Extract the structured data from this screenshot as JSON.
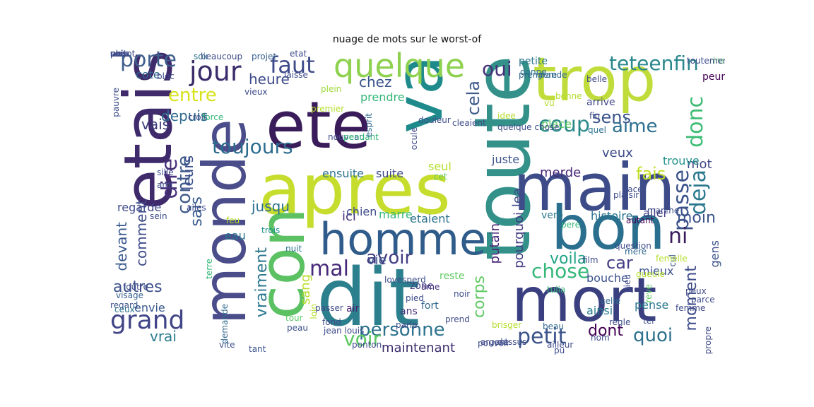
{
  "title": "nuage de mots sur le worst-of",
  "words": [
    {
      "t": "ete",
      "c": "#3b1c5a"
    },
    {
      "t": "etais",
      "c": "#3f2a6b"
    },
    {
      "t": "monde",
      "c": "#4a4d8a"
    },
    {
      "t": "apres",
      "c": "#c6dd2e"
    },
    {
      "t": "dit",
      "c": "#2c7f8c"
    },
    {
      "t": "toute",
      "c": "#33918a"
    },
    {
      "t": "main",
      "c": "#3d4c89"
    },
    {
      "t": "trop",
      "c": "#bfdc3a"
    },
    {
      "t": "bon",
      "c": "#2a6f8e"
    },
    {
      "t": "mort",
      "c": "#3a3f7f"
    },
    {
      "t": "va",
      "c": "#1e8a8b"
    },
    {
      "t": "con",
      "c": "#5bc163"
    },
    {
      "t": "homme",
      "c": "#2f5c8a"
    },
    {
      "t": "quelque",
      "c": "#8ed14f"
    },
    {
      "t": "jour",
      "c": "#3b2c6a"
    },
    {
      "t": "faut",
      "c": "#3e4a89"
    },
    {
      "t": "teteenfin",
      "c": "#2a878c"
    },
    {
      "t": "porte",
      "c": "#3f5f8d"
    },
    {
      "t": "entre",
      "c": "#d8e21f"
    },
    {
      "t": "toujours",
      "c": "#2d6d8e"
    },
    {
      "t": "coup",
      "c": "#2a8a89"
    },
    {
      "t": "oui",
      "c": "#46317a"
    },
    {
      "t": "cela",
      "c": "#3e5a8c"
    },
    {
      "t": "donc",
      "c": "#3dbc74"
    },
    {
      "t": "aime",
      "c": "#2c6f8e"
    },
    {
      "t": "sens",
      "c": "#3a548b"
    },
    {
      "t": "heure",
      "c": "#3e4b89"
    },
    {
      "t": "depuis",
      "c": "#2e6a8e"
    },
    {
      "t": "vais",
      "c": "#3d3b7c"
    },
    {
      "t": "grand",
      "c": "#414487"
    },
    {
      "t": "autres",
      "c": "#3c518b"
    },
    {
      "t": "dire",
      "c": "#46307a"
    },
    {
      "t": "contre",
      "c": "#3f5a8c"
    },
    {
      "t": "mal",
      "c": "#482979"
    },
    {
      "t": "avoir",
      "c": "#433e85"
    },
    {
      "t": "chose",
      "c": "#35b779"
    },
    {
      "t": "car",
      "c": "#433d84"
    },
    {
      "t": "deja",
      "c": "#2a788e"
    },
    {
      "t": "passe",
      "c": "#3b528b"
    },
    {
      "t": "personne",
      "c": "#2c728e"
    },
    {
      "t": "voir",
      "c": "#5ec962"
    },
    {
      "t": "quoi",
      "c": "#2c728e"
    },
    {
      "t": "petit",
      "c": "#3b528b"
    },
    {
      "t": "dont",
      "c": "#440154"
    },
    {
      "t": "maintenant",
      "c": "#3b2e6e"
    },
    {
      "t": "vrai",
      "c": "#2a7a8e"
    },
    {
      "t": "moin",
      "c": "#3b528b"
    },
    {
      "t": "ni",
      "c": "#3a1c5c"
    },
    {
      "t": "merde",
      "c": "#482777"
    },
    {
      "t": "mot",
      "c": "#404688"
    },
    {
      "t": "fais",
      "c": "#c2df23"
    },
    {
      "t": "veux",
      "c": "#3e4c8a"
    },
    {
      "t": "chez",
      "c": "#3a548c"
    },
    {
      "t": "jusqu",
      "c": "#2d708e"
    },
    {
      "t": "vraiment",
      "c": "#2a778e"
    },
    {
      "t": "sang",
      "c": "#b8de29"
    },
    {
      "t": "corps",
      "c": "#5ec962"
    },
    {
      "t": "moment",
      "c": "#3e4a89"
    },
    {
      "t": "devant",
      "c": "#38588c"
    },
    {
      "t": "comment",
      "c": "#3e4c8a"
    },
    {
      "t": "sais",
      "c": "#38598c"
    },
    {
      "t": "leurs",
      "c": "#3c4f8a"
    },
    {
      "t": "envie",
      "c": "#38588c"
    },
    {
      "t": "vie",
      "c": "#3b518b"
    },
    {
      "t": "eau",
      "c": "#2a788e"
    },
    {
      "t": "ici",
      "c": "#472d7b"
    },
    {
      "t": "chien",
      "c": "#3d4d8a"
    },
    {
      "t": "marre",
      "c": "#35b779"
    },
    {
      "t": "etaient",
      "c": "#2c728e"
    },
    {
      "t": "putain",
      "c": "#482677"
    },
    {
      "t": "histoire",
      "c": "#2b748e"
    },
    {
      "t": "aller",
      "c": "#433e85"
    },
    {
      "t": "mieux",
      "c": "#3b528b"
    },
    {
      "t": "bouche",
      "c": "#3b528b"
    },
    {
      "t": "ainsi",
      "c": "#287d8e"
    },
    {
      "t": "pense",
      "c": "#2a788e"
    },
    {
      "t": "trouve",
      "c": "#21918c"
    },
    {
      "t": "juste",
      "c": "#3b528b"
    },
    {
      "t": "seul",
      "c": "#b5de2b"
    },
    {
      "t": "suite",
      "c": "#3e4a89"
    },
    {
      "t": "ensuite",
      "c": "#2c728e"
    },
    {
      "t": "cote",
      "c": "#31688e"
    },
    {
      "t": "regarde",
      "c": "#3e4989"
    },
    {
      "t": "place",
      "c": "#5ec962"
    },
    {
      "t": "lea",
      "c": "#3e4c8a"
    },
    {
      "t": "pourquoi",
      "c": "#433e85"
    },
    {
      "t": "vero",
      "c": "#2a788e"
    },
    {
      "t": "petite",
      "c": "#2a788e"
    },
    {
      "t": "prendre",
      "c": "#35b779"
    },
    {
      "t": "arrive",
      "c": "#404688"
    },
    {
      "t": "voila",
      "c": "#20a486"
    },
    {
      "t": "peur",
      "c": "#440154"
    },
    {
      "t": "zone",
      "c": "#433e85"
    },
    {
      "t": "reste",
      "c": "#5ec962"
    },
    {
      "t": "fort",
      "c": "#31688e"
    },
    {
      "t": "ans",
      "c": "#46327e"
    },
    {
      "t": "air",
      "c": "#482173"
    },
    {
      "t": "gens",
      "c": "#3b528b"
    },
    {
      "t": "soir",
      "c": "#2c728e"
    },
    {
      "t": "projet",
      "c": "#35608d"
    },
    {
      "t": "plein",
      "c": "#9fda3a"
    },
    {
      "t": "belle",
      "c": "#3e4a89"
    },
    {
      "t": "bonne",
      "c": "#b5de2b"
    },
    {
      "t": "autant",
      "c": "#440154"
    },
    {
      "t": "regard",
      "c": "#3b528b"
    },
    {
      "t": "ceux",
      "c": "#2c728e"
    },
    {
      "t": "femme",
      "c": "#3e4a89"
    },
    {
      "t": "beau",
      "c": "#31688e"
    },
    {
      "t": "tel",
      "c": "#3e4c8a"
    },
    {
      "t": "tant",
      "c": "#3b528b"
    },
    {
      "t": "nuit",
      "c": "#2c728e"
    },
    {
      "t": "vite",
      "c": "#3b528b"
    },
    {
      "t": "donne",
      "c": "#2c728e"
    },
    {
      "t": "vu",
      "c": "#b5de2b"
    },
    {
      "t": "pere",
      "c": "#35b779"
    },
    {
      "t": "film",
      "c": "#3e4c8a"
    },
    {
      "t": "mere",
      "c": "#31688e"
    },
    {
      "t": "dieu",
      "c": "#3e4c8a"
    },
    {
      "t": "reve",
      "c": "#5ec962"
    },
    {
      "t": "parce",
      "c": "#3e4c8a"
    },
    {
      "t": "cul",
      "c": "#3b528b"
    },
    {
      "t": "trois",
      "c": "#21918c"
    },
    {
      "t": "terre",
      "c": "#35b779"
    },
    {
      "t": "visage",
      "c": "#35608d"
    },
    {
      "t": "foutre",
      "c": "#3e4c8a"
    },
    {
      "t": "rire",
      "c": "#5ec962"
    },
    {
      "t": "quel",
      "c": "#2c728e"
    },
    {
      "t": "fin",
      "c": "#3e4c8a"
    },
    {
      "t": "premier",
      "c": "#b5de2b"
    },
    {
      "t": "nouveau",
      "c": "#3e4c8a"
    },
    {
      "t": "pendant",
      "c": "#35b779"
    },
    {
      "t": "tulia",
      "c": "#35b779"
    },
    {
      "t": "ame",
      "c": "#46327e"
    },
    {
      "t": "noir",
      "c": "#3e4c8a"
    },
    {
      "t": "loin",
      "c": "#b5de2b"
    },
    {
      "t": "peau",
      "c": "#3b528b"
    },
    {
      "t": "tour",
      "c": "#5ec962"
    },
    {
      "t": "pied",
      "c": "#3e4c8a"
    },
    {
      "t": "prend",
      "c": "#3e4c8a"
    },
    {
      "t": "celle",
      "c": "#31688e"
    },
    {
      "t": "ailleur",
      "c": "#3e4c8a"
    },
    {
      "t": "idee",
      "c": "#b5de2b"
    },
    {
      "t": "face",
      "c": "#3e4c8a"
    },
    {
      "t": "cet",
      "c": "#5ec962"
    },
    {
      "t": "croit",
      "c": "#3e4c8a"
    },
    {
      "t": "force",
      "c": "#35b779"
    },
    {
      "t": "pauvre",
      "c": "#3e4c8a"
    },
    {
      "t": "demande",
      "c": "#31688e"
    },
    {
      "t": "ami",
      "c": "#3e4c8a"
    },
    {
      "t": "beaucoup",
      "c": "#3e4c8a"
    },
    {
      "t": "etat",
      "c": "#3e4c8a"
    },
    {
      "t": "vieux",
      "c": "#3e4c8a"
    },
    {
      "t": "laisse",
      "c": "#3e4c8a"
    },
    {
      "t": "premiere",
      "c": "#31688e"
    },
    {
      "t": "grande",
      "c": "#31688e"
    },
    {
      "t": "esprit",
      "c": "#31688e"
    },
    {
      "t": "douleur",
      "c": "#3e4c8a"
    },
    {
      "t": "cleaient",
      "c": "#3e4c8a"
    },
    {
      "t": "quelque chose",
      "c": "#3e4c8a"
    },
    {
      "t": "sein",
      "c": "#3e4c8a"
    },
    {
      "t": "feu",
      "c": "#b5de2b"
    },
    {
      "t": "gueule",
      "c": "#b5de2b"
    },
    {
      "t": "pouvoir",
      "c": "#3e4c8a"
    },
    {
      "t": "argent",
      "c": "#3e4c8a"
    },
    {
      "t": "dessus",
      "c": "#3e4c8a"
    },
    {
      "t": "pu",
      "c": "#3e4c8a"
    },
    {
      "t": "nom",
      "c": "#3e4c8a"
    },
    {
      "t": "regle",
      "c": "#3e4c8a"
    },
    {
      "t": "propre",
      "c": "#3e4c8a"
    },
    {
      "t": "marche",
      "c": "#3e4c8a"
    },
    {
      "t": "plaisir",
      "c": "#3e4c8a"
    },
    {
      "t": "toutement",
      "c": "#3e4c8a"
    },
    {
      "t": "bloc",
      "c": "#3e4c8a"
    },
    {
      "t": "ocule",
      "c": "#3e4c8a"
    },
    {
      "t": "sille",
      "c": "#3e4c8a"
    },
    {
      "t": "ailes",
      "c": "#3e4c8a"
    },
    {
      "t": "passer",
      "c": "#3e4c8a"
    },
    {
      "t": "brisger",
      "c": "#b5de2b"
    },
    {
      "t": "ponton",
      "c": "#3e4c8a"
    },
    {
      "t": "fond",
      "c": "#3e4c8a"
    },
    {
      "t": "parle",
      "c": "#3e4c8a"
    },
    {
      "t": "lovesperd",
      "c": "#3e4c8a"
    },
    {
      "t": "jean louis",
      "c": "#3e4c8a"
    },
    {
      "t": "femelle",
      "c": "#b5de2b"
    },
    {
      "t": "question",
      "c": "#3e4c8a"
    },
    {
      "t": "peux",
      "c": "#3e4c8a"
    },
    {
      "t": "vois",
      "c": "#3e4c8a"
    },
    {
      "t": "plutot",
      "c": "#3e4c8a"
    },
    {
      "t": "rue",
      "c": "#3e4c8a"
    },
    {
      "t": "pere",
      "c": "#3e4c8a"
    },
    {
      "t": "nuit",
      "c": "#3e4c8a"
    },
    {
      "t": "ou",
      "c": "#3e4c8a"
    },
    {
      "t": "ur",
      "c": "#3e4c8a"
    },
    {
      "t": "ne",
      "c": "#3e4c8a"
    },
    {
      "t": "sous",
      "c": "#3e4c8a"
    }
  ]
}
